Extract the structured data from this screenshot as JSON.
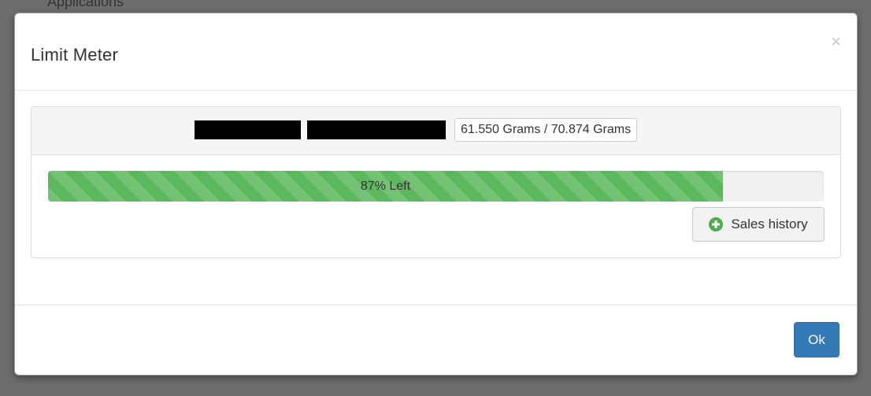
{
  "background": {
    "partial_text": "Applications"
  },
  "modal": {
    "title": "Limit Meter",
    "close_symbol": "×",
    "usage": {
      "label": "61.550 Grams / 70.874 Grams",
      "used": 61.55,
      "limit": 70.874,
      "unit": "Grams"
    },
    "progress": {
      "label": "87% Left",
      "percent_left": 87,
      "color": "#5cb85c"
    },
    "sales_history_button": {
      "label": "Sales history",
      "icon": "plus-circle-icon"
    },
    "ok_button": {
      "label": "Ok",
      "color": "#337ab7"
    }
  }
}
